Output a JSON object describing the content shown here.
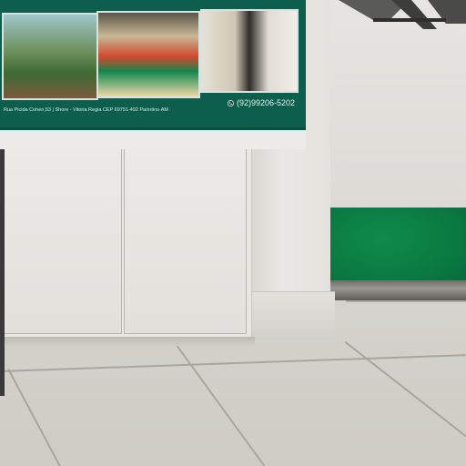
{
  "banner": {
    "address_text": "Rua Picida Cohen,53 | Shore - Vitoria Regia CEP 69751-492 Parintins-AM",
    "phone_text": "(92)99206-5202"
  },
  "colors": {
    "banner_green": "#0d5e4d",
    "mat_green": "#0a7a42",
    "floor": "#d9d7d1"
  },
  "icons": {
    "phone": "phone-icon"
  }
}
